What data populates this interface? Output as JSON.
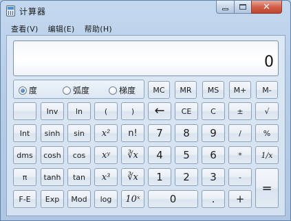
{
  "window": {
    "title": "计算器",
    "controls": {
      "minimize": "minimize",
      "maximize": "maximize",
      "close": "✕"
    }
  },
  "menu": [
    "查看(V)",
    "编辑(E)",
    "帮助(H)"
  ],
  "display": {
    "value": "0"
  },
  "angle_modes": [
    {
      "label": "度",
      "checked": true
    },
    {
      "label": "弧度",
      "checked": false
    },
    {
      "label": "梯度",
      "checked": false
    }
  ],
  "keys": {
    "memory": [
      "MC",
      "MR",
      "MS",
      "M+",
      "M-"
    ],
    "r2": [
      "",
      "Inv",
      "ln",
      "(",
      ")",
      "←",
      "CE",
      "C",
      "±",
      "√"
    ],
    "r3": [
      "Int",
      "sinh",
      "sin",
      "x²",
      "n!",
      "7",
      "8",
      "9",
      "/",
      "%"
    ],
    "r4": [
      "dms",
      "cosh",
      "cos",
      "xʸ",
      "∛x",
      "4",
      "5",
      "6",
      "*",
      "1/x"
    ],
    "r5": [
      "π",
      "tanh",
      "tan",
      "x³",
      "∛x",
      "1",
      "2",
      "3",
      "-",
      "="
    ],
    "r6": [
      "F-E",
      "Exp",
      "Mod",
      "log",
      "10ˣ",
      "0",
      ".",
      "+"
    ]
  }
}
